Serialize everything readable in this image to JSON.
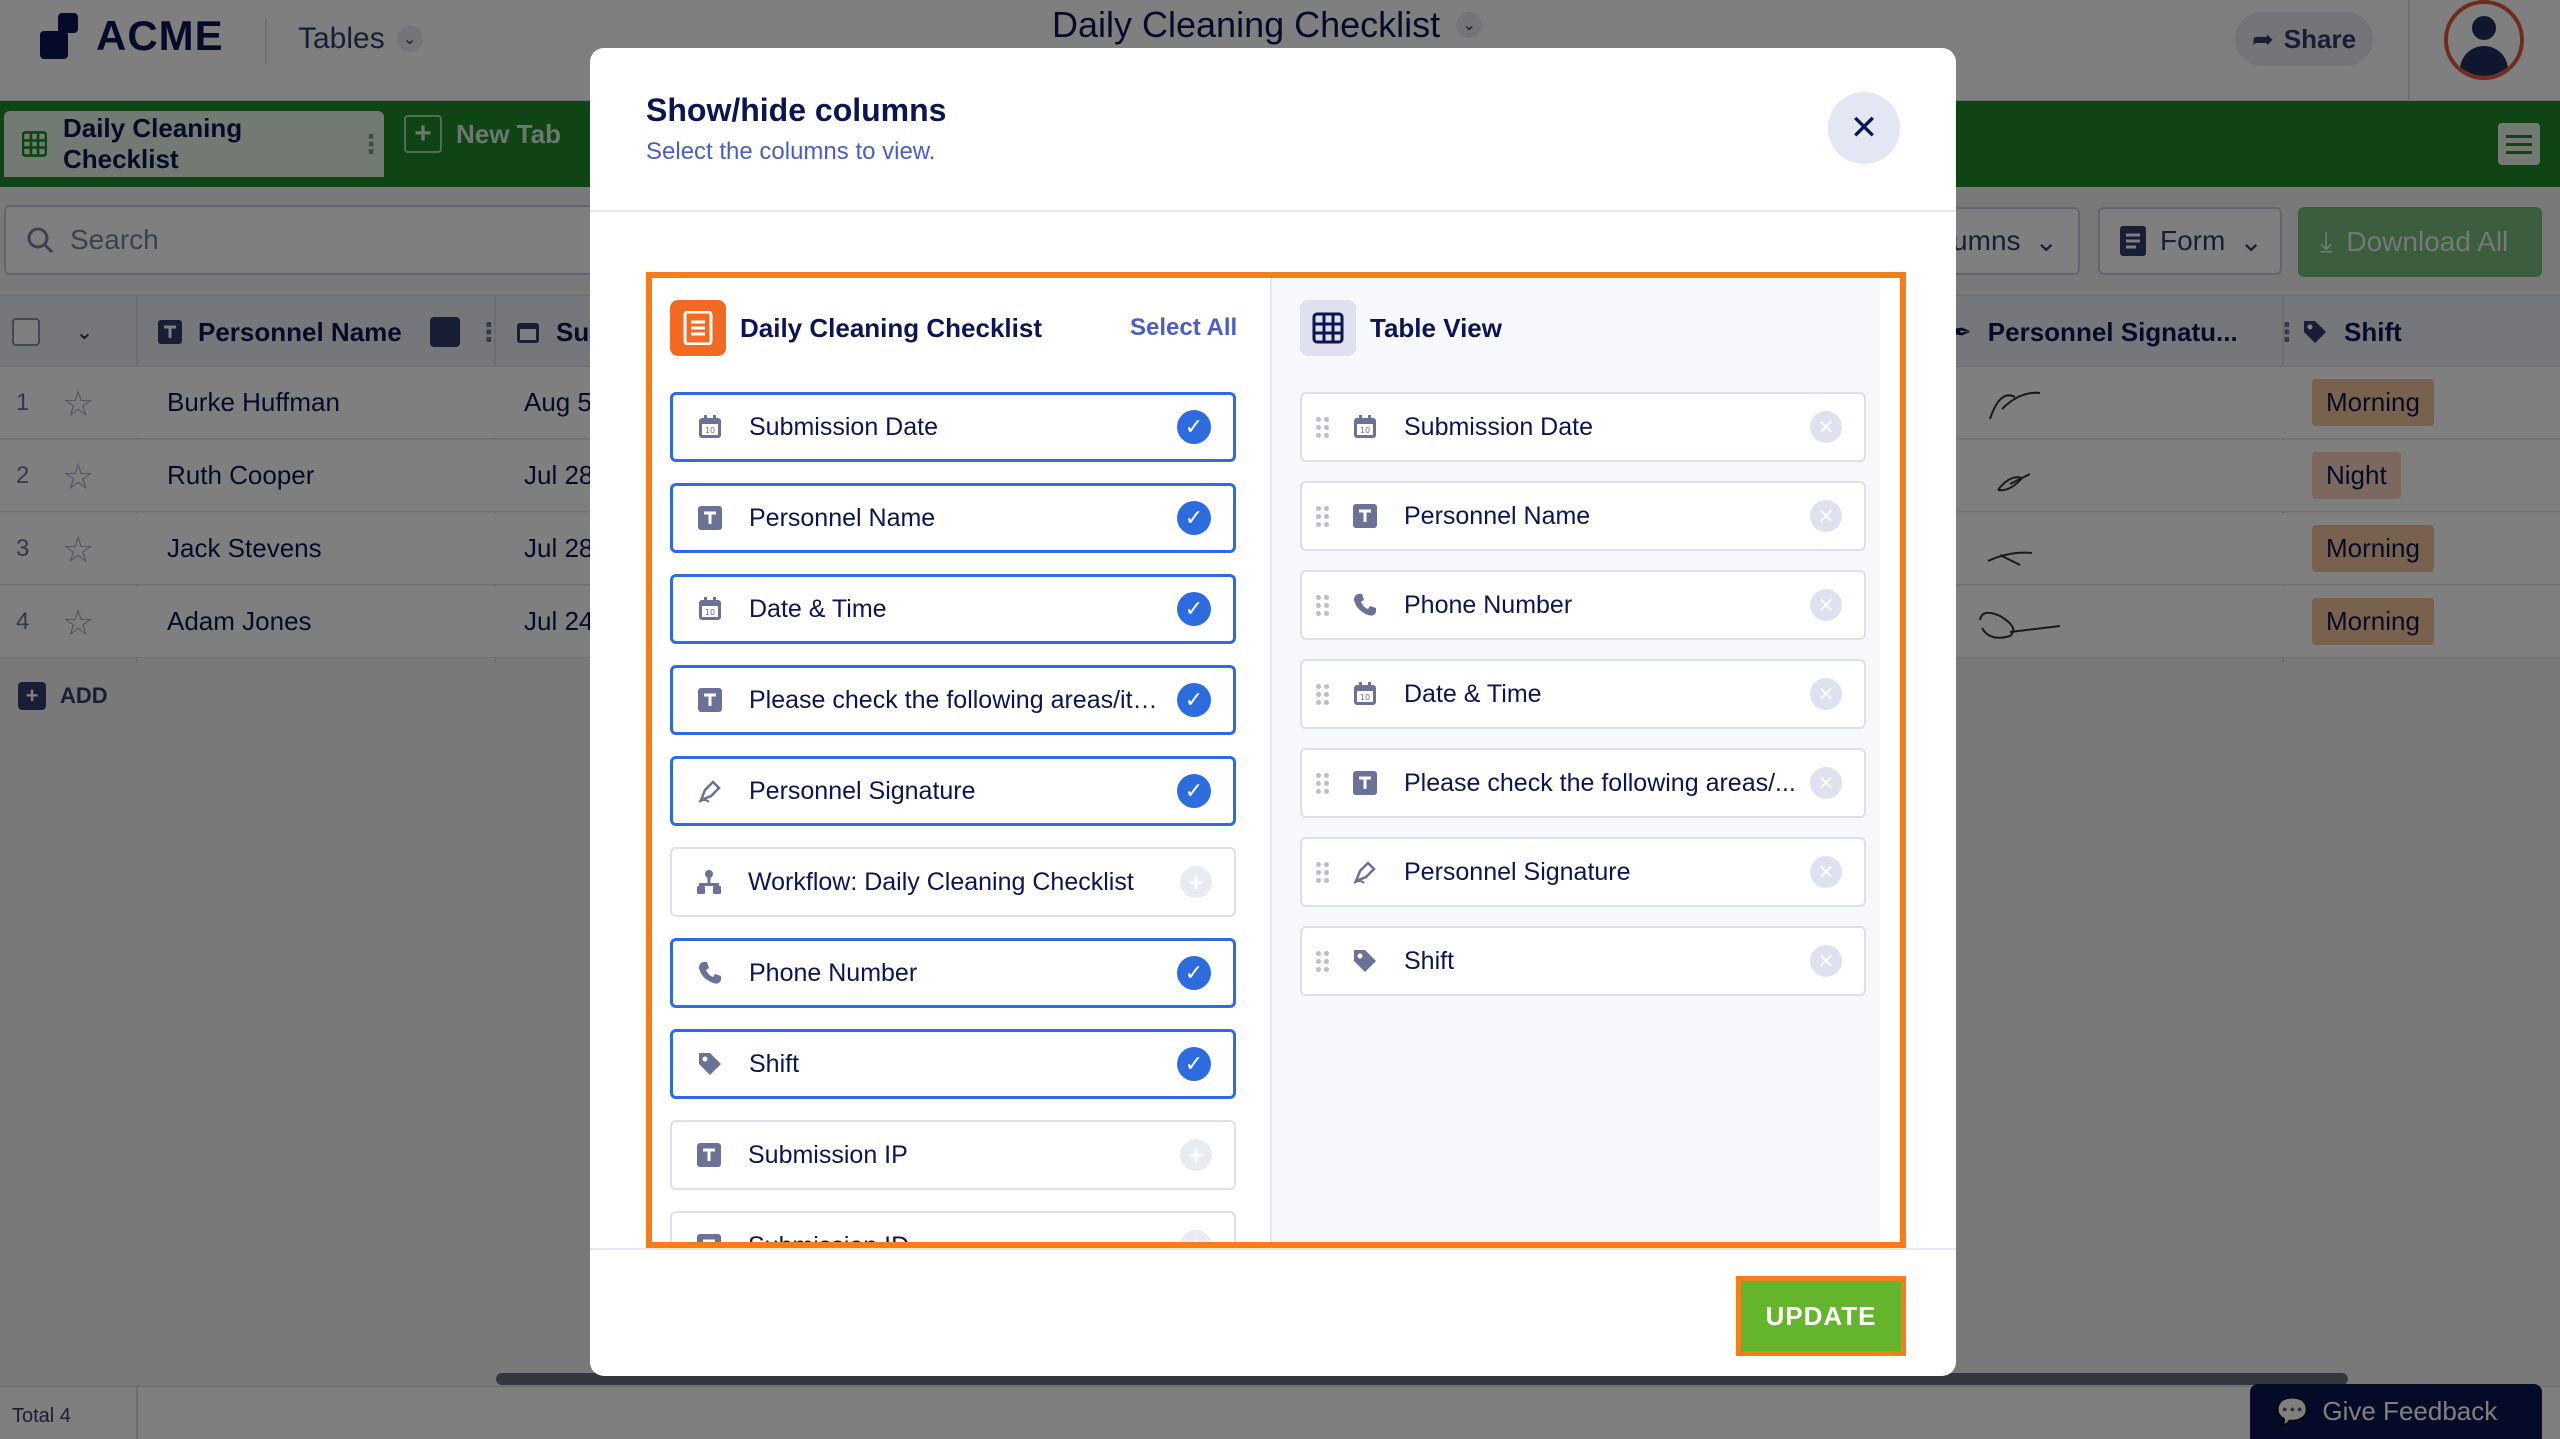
{
  "app": {
    "logo_text": "ACME",
    "tables_label": "Tables",
    "doc_title": "Daily Cleaning Checklist",
    "share_label": "Share"
  },
  "tabs": {
    "active_label": "Daily Cleaning Checklist",
    "new_tab_label": "New Tab"
  },
  "toolbar": {
    "search_placeholder": "Search",
    "columns_label": "lumns",
    "form_label": "Form",
    "download_label": "Download All"
  },
  "grid": {
    "headers": {
      "personnel_name": "Personnel Name",
      "submission": "Sul",
      "personnel_signature": "Personnel Signatu...",
      "shift": "Shift"
    },
    "rows": [
      {
        "num": "1",
        "name": "Burke Huffman",
        "date": "Aug 5",
        "shift": "Morning"
      },
      {
        "num": "2",
        "name": "Ruth Cooper",
        "date": "Jul 28",
        "shift": "Night"
      },
      {
        "num": "3",
        "name": "Jack Stevens",
        "date": "Jul 28",
        "shift": "Morning"
      },
      {
        "num": "4",
        "name": "Adam Jones",
        "date": "Jul 24",
        "shift": "Morning"
      }
    ],
    "add_label": "ADD",
    "total_label": "Total 4"
  },
  "feedback_label": "Give Feedback",
  "modal": {
    "title": "Show/hide columns",
    "subtitle": "Select the columns to view.",
    "left_title": "Daily Cleaning Checklist",
    "select_all": "Select All",
    "right_title": "Table View",
    "available_columns": [
      {
        "label": "Submission Date",
        "icon": "calendar-icon",
        "selected": true
      },
      {
        "label": "Personnel Name",
        "icon": "text-field-icon",
        "selected": true
      },
      {
        "label": "Date & Time",
        "icon": "calendar-icon",
        "selected": true
      },
      {
        "label": "Please check the following areas/ite...",
        "icon": "text-field-icon",
        "selected": true
      },
      {
        "label": "Personnel Signature",
        "icon": "signature-pen-icon",
        "selected": true
      },
      {
        "label": "Workflow: Daily Cleaning Checklist",
        "icon": "workflow-icon",
        "selected": false
      },
      {
        "label": "Phone Number",
        "icon": "phone-icon",
        "selected": true
      },
      {
        "label": "Shift",
        "icon": "tag-icon",
        "selected": true
      },
      {
        "label": "Submission IP",
        "icon": "text-field-icon",
        "selected": false
      },
      {
        "label": "Submission ID",
        "icon": "text-field-icon",
        "selected": false
      }
    ],
    "table_view_columns": [
      {
        "label": "Submission Date",
        "icon": "calendar-icon"
      },
      {
        "label": "Personnel Name",
        "icon": "text-field-icon"
      },
      {
        "label": "Phone Number",
        "icon": "phone-icon"
      },
      {
        "label": "Date & Time",
        "icon": "calendar-icon"
      },
      {
        "label": "Please check the following areas/...",
        "icon": "text-field-icon"
      },
      {
        "label": "Personnel Signature",
        "icon": "signature-pen-icon"
      },
      {
        "label": "Shift",
        "icon": "tag-icon"
      }
    ],
    "update_label": "UPDATE"
  },
  "colors": {
    "brand_green": "#1f8b2b",
    "accent_blue": "#2d6cdf",
    "highlight_orange": "#f77c1a",
    "update_green": "#64b52b",
    "shift_morning": "#f2c49b",
    "shift_night": "#f6d3c0"
  }
}
